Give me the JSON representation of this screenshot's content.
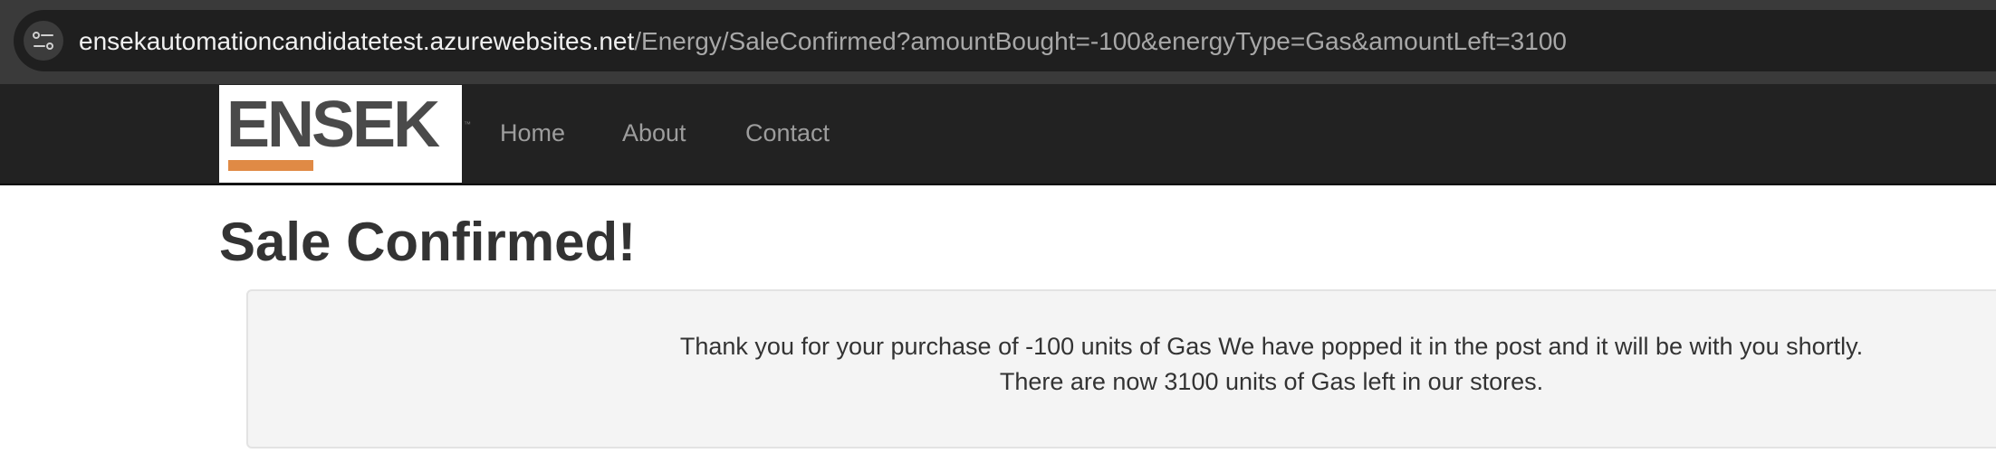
{
  "browser": {
    "url_host": "ensekautomationcandidatetest.azurewebsites.net",
    "url_path": "/Energy/SaleConfirmed?amountBought=-100&energyType=Gas&amountLeft=3100",
    "site_info_icon": "tune-icon"
  },
  "navbar": {
    "logo_text": "ENSEK",
    "logo_accent_color": "#e08a45",
    "links": [
      {
        "label": "Home"
      },
      {
        "label": "About"
      },
      {
        "label": "Contact"
      }
    ]
  },
  "main": {
    "title": "Sale Confirmed!",
    "message_line_1": "Thank you for your purchase of -100 units of Gas We have popped it in the post and it will be with you shortly.",
    "message_line_2": "There are now 3100 units of Gas left in our stores."
  }
}
